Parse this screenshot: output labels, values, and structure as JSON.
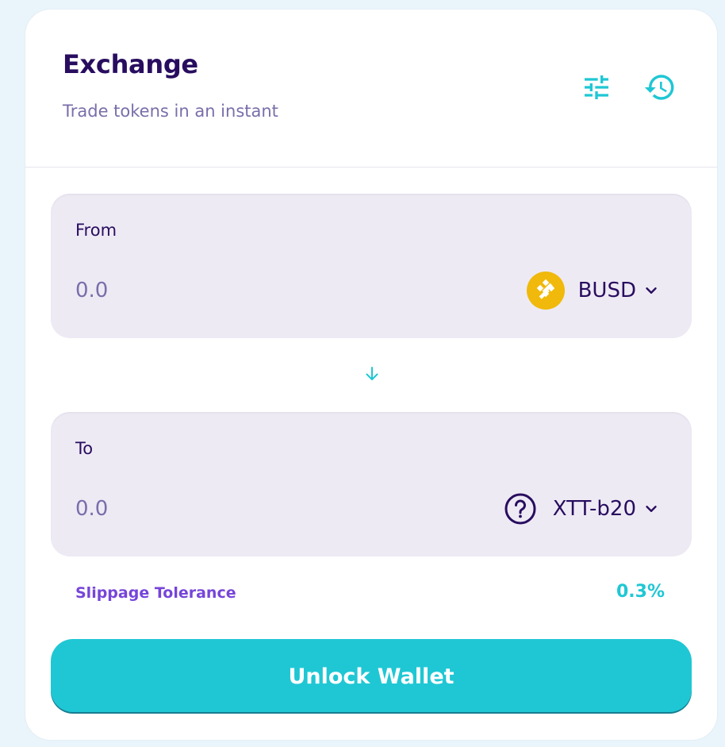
{
  "header": {
    "title": "Exchange",
    "subtitle": "Trade tokens in an instant",
    "icons": [
      "settings-sliders-icon",
      "history-icon"
    ]
  },
  "from": {
    "label": "From",
    "amount_placeholder": "0.0",
    "token": {
      "symbol": "BUSD",
      "icon": "busd-token-icon",
      "icon_color": "#f0b90b"
    }
  },
  "swap": {
    "icon": "arrow-down-icon"
  },
  "to": {
    "label": "To",
    "amount_placeholder": "0.0",
    "token": {
      "symbol": "XTT-b20",
      "icon": "question-circle-icon"
    }
  },
  "slippage": {
    "label": "Slippage Tolerance",
    "value": "0.3%"
  },
  "action": {
    "label": "Unlock Wallet"
  },
  "colors": {
    "primary": "#1fc7d4",
    "text": "#280d5f",
    "text_subtle": "#7a6eaa",
    "secondary": "#7645d9",
    "input_bg": "#eeeaf4"
  }
}
